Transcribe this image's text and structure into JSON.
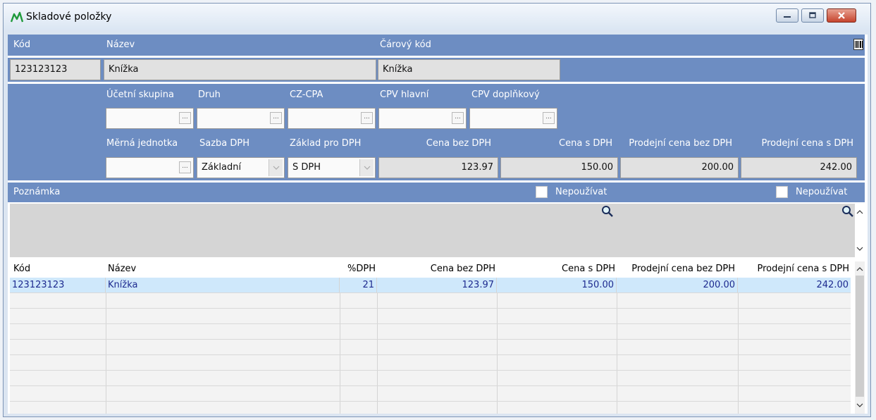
{
  "window": {
    "title": "Skladové položky",
    "buttons": [
      "minimize-icon",
      "restore-icon",
      "close-icon"
    ]
  },
  "form": {
    "row1_labels": {
      "kod": "Kód",
      "nazev": "Název",
      "carovy_kod": "Čárový kód"
    },
    "row1_values": {
      "kod": "123123123",
      "nazev": "Knížka",
      "carovy_kod": "Knížka"
    },
    "row2_labels": {
      "ucetni_skupina": "Účetní skupina",
      "druh": "Druh",
      "cz_cpa": "CZ-CPA",
      "cpv_hlavni": "CPV hlavní",
      "cpv_doplnkovy": "CPV doplňkový"
    },
    "ellipsis": "...",
    "row3_labels": {
      "merna_jednotka": "Měrná jednotka",
      "sazba_dph": "Sazba DPH",
      "zaklad_pro_dph": "Základ pro DPH",
      "cena_bez_dph": "Cena bez DPH",
      "cena_s_dph": "Cena s DPH",
      "prodejni_bez": "Prodejní cena bez DPH",
      "prodejni_s": "Prodejní cena s DPH"
    },
    "row3_values": {
      "merna_jednotka": "",
      "sazba_dph": "Základní",
      "zaklad_pro_dph": "S DPH",
      "cena_bez_dph": "123.97",
      "cena_s_dph": "150.00",
      "prodejni_bez": "200.00",
      "prodejni_s": "242.00"
    },
    "note_label": "Poznámka",
    "nepouzivat_1": "Nepoužívat",
    "nepouzivat_2": "Nepoužívat",
    "nepouzivat_1_checked": false,
    "nepouzivat_2_checked": false
  },
  "grid": {
    "columns": [
      "Kód",
      "Název",
      "%DPH",
      "Cena bez DPH",
      "Cena s DPH",
      "Prodejní cena bez DPH",
      "Prodejní cena s DPH"
    ],
    "rows": [
      [
        "123123123",
        "Knížka",
        "21",
        "123.97",
        "150.00",
        "200.00",
        "242.00"
      ]
    ]
  },
  "colors": {
    "panel_blue": "#6d8dc2",
    "selected_row": "#cfe8fb",
    "value_text": "#1d2a8f"
  }
}
